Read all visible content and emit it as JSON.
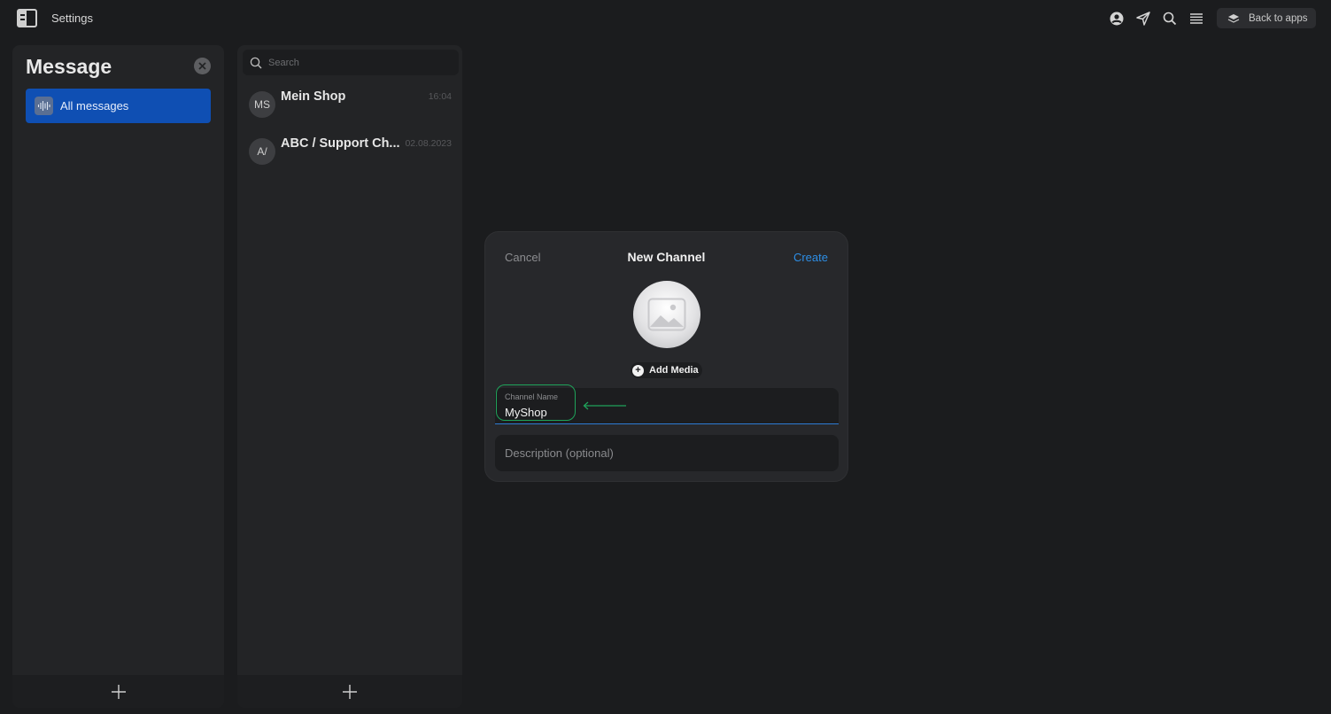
{
  "topbar": {
    "title": "Settings",
    "back_label": "Back to apps",
    "icons": [
      "user-circle-icon",
      "send-icon",
      "search-icon",
      "menu-lines-icon"
    ]
  },
  "left_panel": {
    "heading": "Message",
    "nav_items": [
      {
        "label": "All messages",
        "icon": "audio-wave-icon",
        "active": true
      }
    ]
  },
  "middle_panel": {
    "search_placeholder": "Search",
    "chats": [
      {
        "avatar": "MS",
        "name": "Mein Shop",
        "time": "16:04"
      },
      {
        "avatar": "A/",
        "name": "ABC / Support Ch...",
        "time": "02.08.2023"
      }
    ]
  },
  "dialog": {
    "cancel_label": "Cancel",
    "title": "New Channel",
    "create_label": "Create",
    "add_media_label": "Add Media",
    "channel_name_label": "Channel Name",
    "channel_name_value": "MyShop",
    "description_placeholder": "Description (optional)"
  },
  "colors": {
    "accent_blue": "#2d8ee6",
    "nav_active": "#0f4fb3",
    "highlight_green": "#1fa35a",
    "background": "#1b1c1e",
    "panel": "#232426"
  }
}
